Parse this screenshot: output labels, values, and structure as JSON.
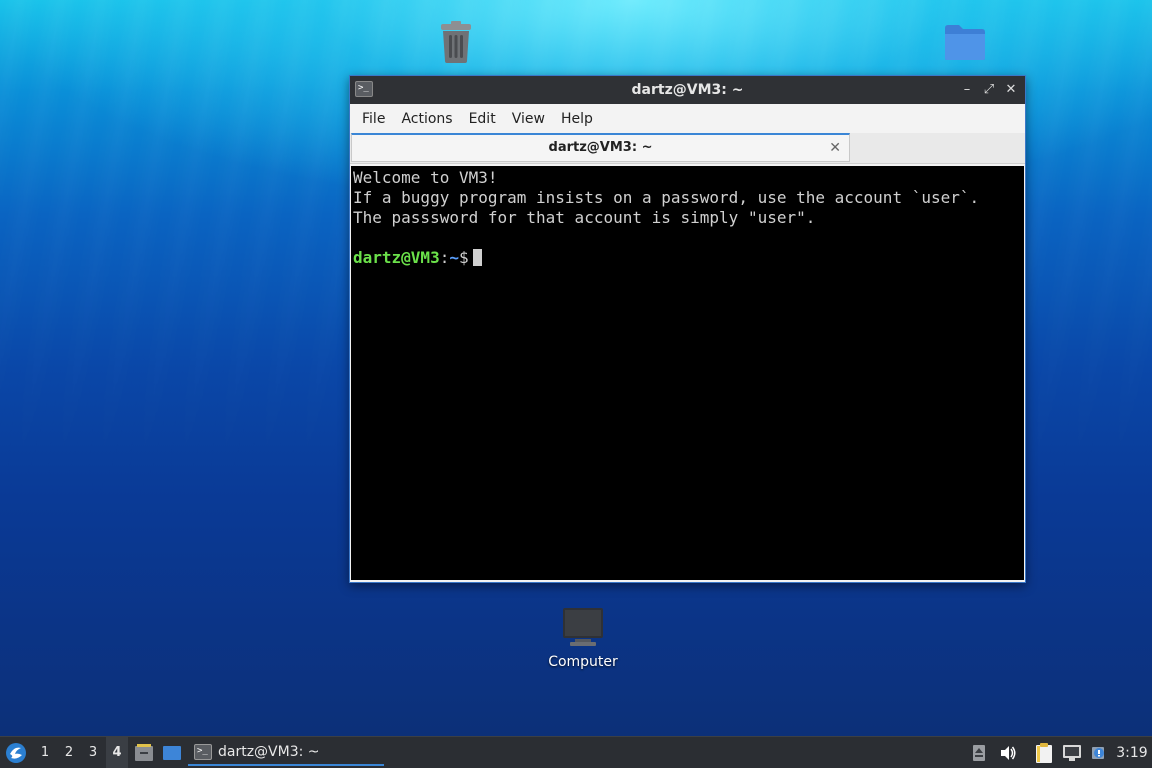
{
  "desktop": {
    "icons": [
      {
        "name": "trash",
        "label": ""
      },
      {
        "name": "folder",
        "label": ""
      },
      {
        "name": "computer",
        "label": "Computer"
      }
    ]
  },
  "window": {
    "title": "dartz@VM3: ~",
    "controls": {
      "minimize": "–",
      "maximize": "⤢",
      "close": "✕"
    },
    "menu": [
      "File",
      "Actions",
      "Edit",
      "View",
      "Help"
    ],
    "tab": {
      "label": "dartz@VM3: ~",
      "close": "✕"
    },
    "terminal": {
      "lines": [
        "Welcome to VM3!",
        "If a buggy program insists on a password, use the account `user`.",
        "The passsword for that account is simply \"user\".",
        ""
      ],
      "prompt": {
        "user_host": "dartz@VM3",
        "sep": ":",
        "path": "~",
        "symbol": "$"
      }
    }
  },
  "taskbar": {
    "workspaces": [
      "1",
      "2",
      "3",
      "4"
    ],
    "active_workspace": "4",
    "task": {
      "label": "dartz@VM3: ~"
    },
    "clock": "3:19"
  },
  "colors": {
    "accent": "#3a86d6",
    "prompt_user": "#6be14a",
    "prompt_path": "#5aa0ff",
    "terminal_bg": "#000000",
    "taskbar_bg": "#2b2e33"
  }
}
